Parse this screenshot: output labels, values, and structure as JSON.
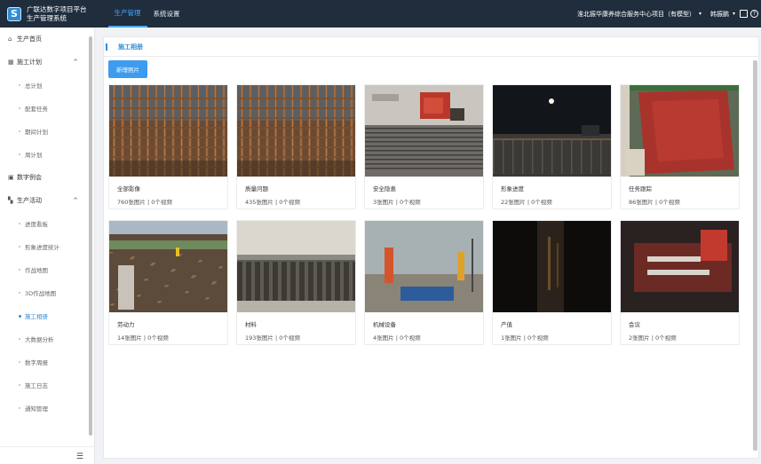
{
  "header": {
    "logo_letter": "S",
    "brand_line1": "广联达数字项目平台",
    "brand_line2": "生产管理系统",
    "nav": [
      "生产管理",
      "系统设置"
    ],
    "project": "淮北振华康养综合服务中心项目（有模型）",
    "user": "韩振鹏",
    "caret": "▾"
  },
  "sidebar": {
    "items": [
      {
        "label": "生产首页",
        "level": 1,
        "icon": "home-icon",
        "glyph": "⌂"
      },
      {
        "label": "施工计划",
        "level": 1,
        "icon": "building-icon",
        "glyph": "▦",
        "expandable": true
      },
      {
        "label": "总计划",
        "level": 2
      },
      {
        "label": "配套任务",
        "level": 2
      },
      {
        "label": "期间计划",
        "level": 2
      },
      {
        "label": "周计划",
        "level": 2
      },
      {
        "label": "数字例会",
        "level": 1,
        "icon": "meeting-icon",
        "glyph": "▣"
      },
      {
        "label": "生产活动",
        "level": 1,
        "icon": "grid-icon",
        "glyph": "▚",
        "expandable": true
      },
      {
        "label": "进度看板",
        "level": 2
      },
      {
        "label": "形象进度统计",
        "level": 2
      },
      {
        "label": "作战地图",
        "level": 2
      },
      {
        "label": "3D作战地图",
        "level": 2
      },
      {
        "label": "施工相册",
        "level": 2,
        "active": true
      },
      {
        "label": "大数据分析",
        "level": 2
      },
      {
        "label": "数字周报",
        "level": 2
      },
      {
        "label": "施工日志",
        "level": 2
      },
      {
        "label": "通知管理",
        "level": 2
      }
    ],
    "fold_glyph": "☰"
  },
  "main": {
    "title": "施工相册",
    "add_button": "新增照片",
    "albums": [
      {
        "name": "全部影像",
        "count": "760张图片 | 0个视频",
        "scene": "rebar"
      },
      {
        "name": "质量问题",
        "count": "435张图片 | 0个视频",
        "scene": "rebar"
      },
      {
        "name": "安全隐患",
        "count": "3张图片 | 0个视频",
        "scene": "machine"
      },
      {
        "name": "形象进度",
        "count": "22张图片 | 0个视频",
        "scene": "night"
      },
      {
        "name": "任务跟踪",
        "count": "86张图片 | 0个视频",
        "scene": "formwork"
      },
      {
        "name": "劳动力",
        "count": "14张图片 | 0个视频",
        "scene": "site"
      },
      {
        "name": "材料",
        "count": "193张图片 | 0个视频",
        "scene": "pipes"
      },
      {
        "name": "机械设备",
        "count": "4张图片 | 0个视频",
        "scene": "flags"
      },
      {
        "name": "产值",
        "count": "1张图片 | 0个视频",
        "scene": "dark"
      },
      {
        "name": "会议",
        "count": "2张图片 | 0个视频",
        "scene": "meeting"
      }
    ]
  },
  "colors": {
    "topbar": "#1f2d3d",
    "accent": "#2f8ed6",
    "button": "#3d9bf0"
  }
}
